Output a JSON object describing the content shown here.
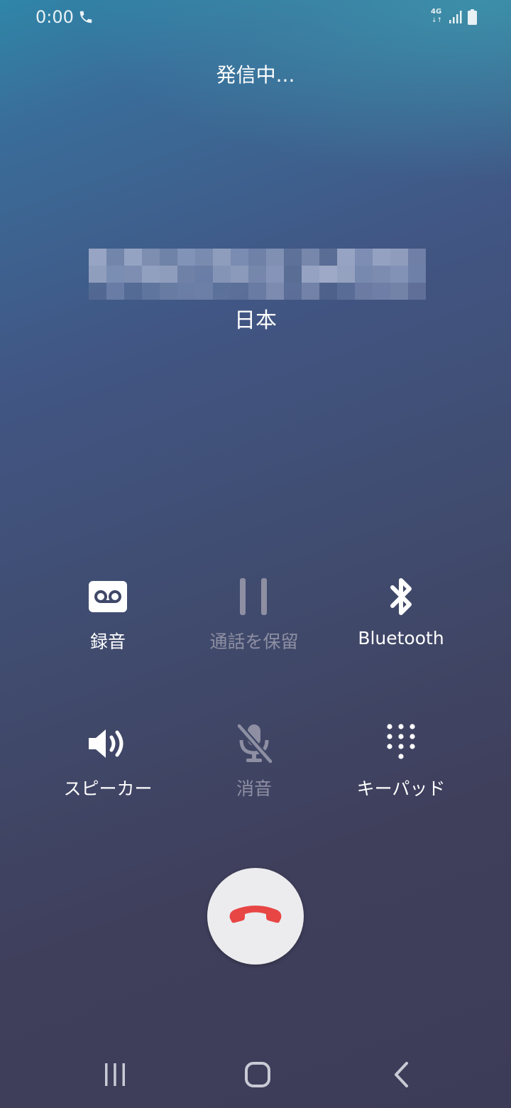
{
  "status_bar": {
    "time": "0:00",
    "call_icon": "phone-icon",
    "network": "4G",
    "network_arrows": "↓↑",
    "signal_icon": "signal-icon",
    "battery_icon": "battery-icon"
  },
  "call": {
    "state": "発信中...",
    "country": "日本"
  },
  "controls": {
    "record": {
      "label": "録音",
      "icon": "voicemail-icon",
      "enabled": true
    },
    "hold": {
      "label": "通話を保留",
      "icon": "pause-icon",
      "enabled": false
    },
    "bluetooth": {
      "label": "Bluetooth",
      "icon": "bluetooth-icon",
      "enabled": true
    },
    "speaker": {
      "label": "スピーカー",
      "icon": "speaker-icon",
      "enabled": true
    },
    "mute": {
      "label": "消音",
      "icon": "mic-off-icon",
      "enabled": false
    },
    "keypad": {
      "label": "キーパッド",
      "icon": "dialpad-icon",
      "enabled": true
    }
  },
  "end_call": {
    "icon": "end-call-icon"
  },
  "navigation": {
    "recents_icon": "recents-icon",
    "home_icon": "home-icon",
    "back_icon": "back-icon"
  },
  "colors": {
    "end_call_red": "#e84545",
    "disabled": "#8e8fa3"
  }
}
